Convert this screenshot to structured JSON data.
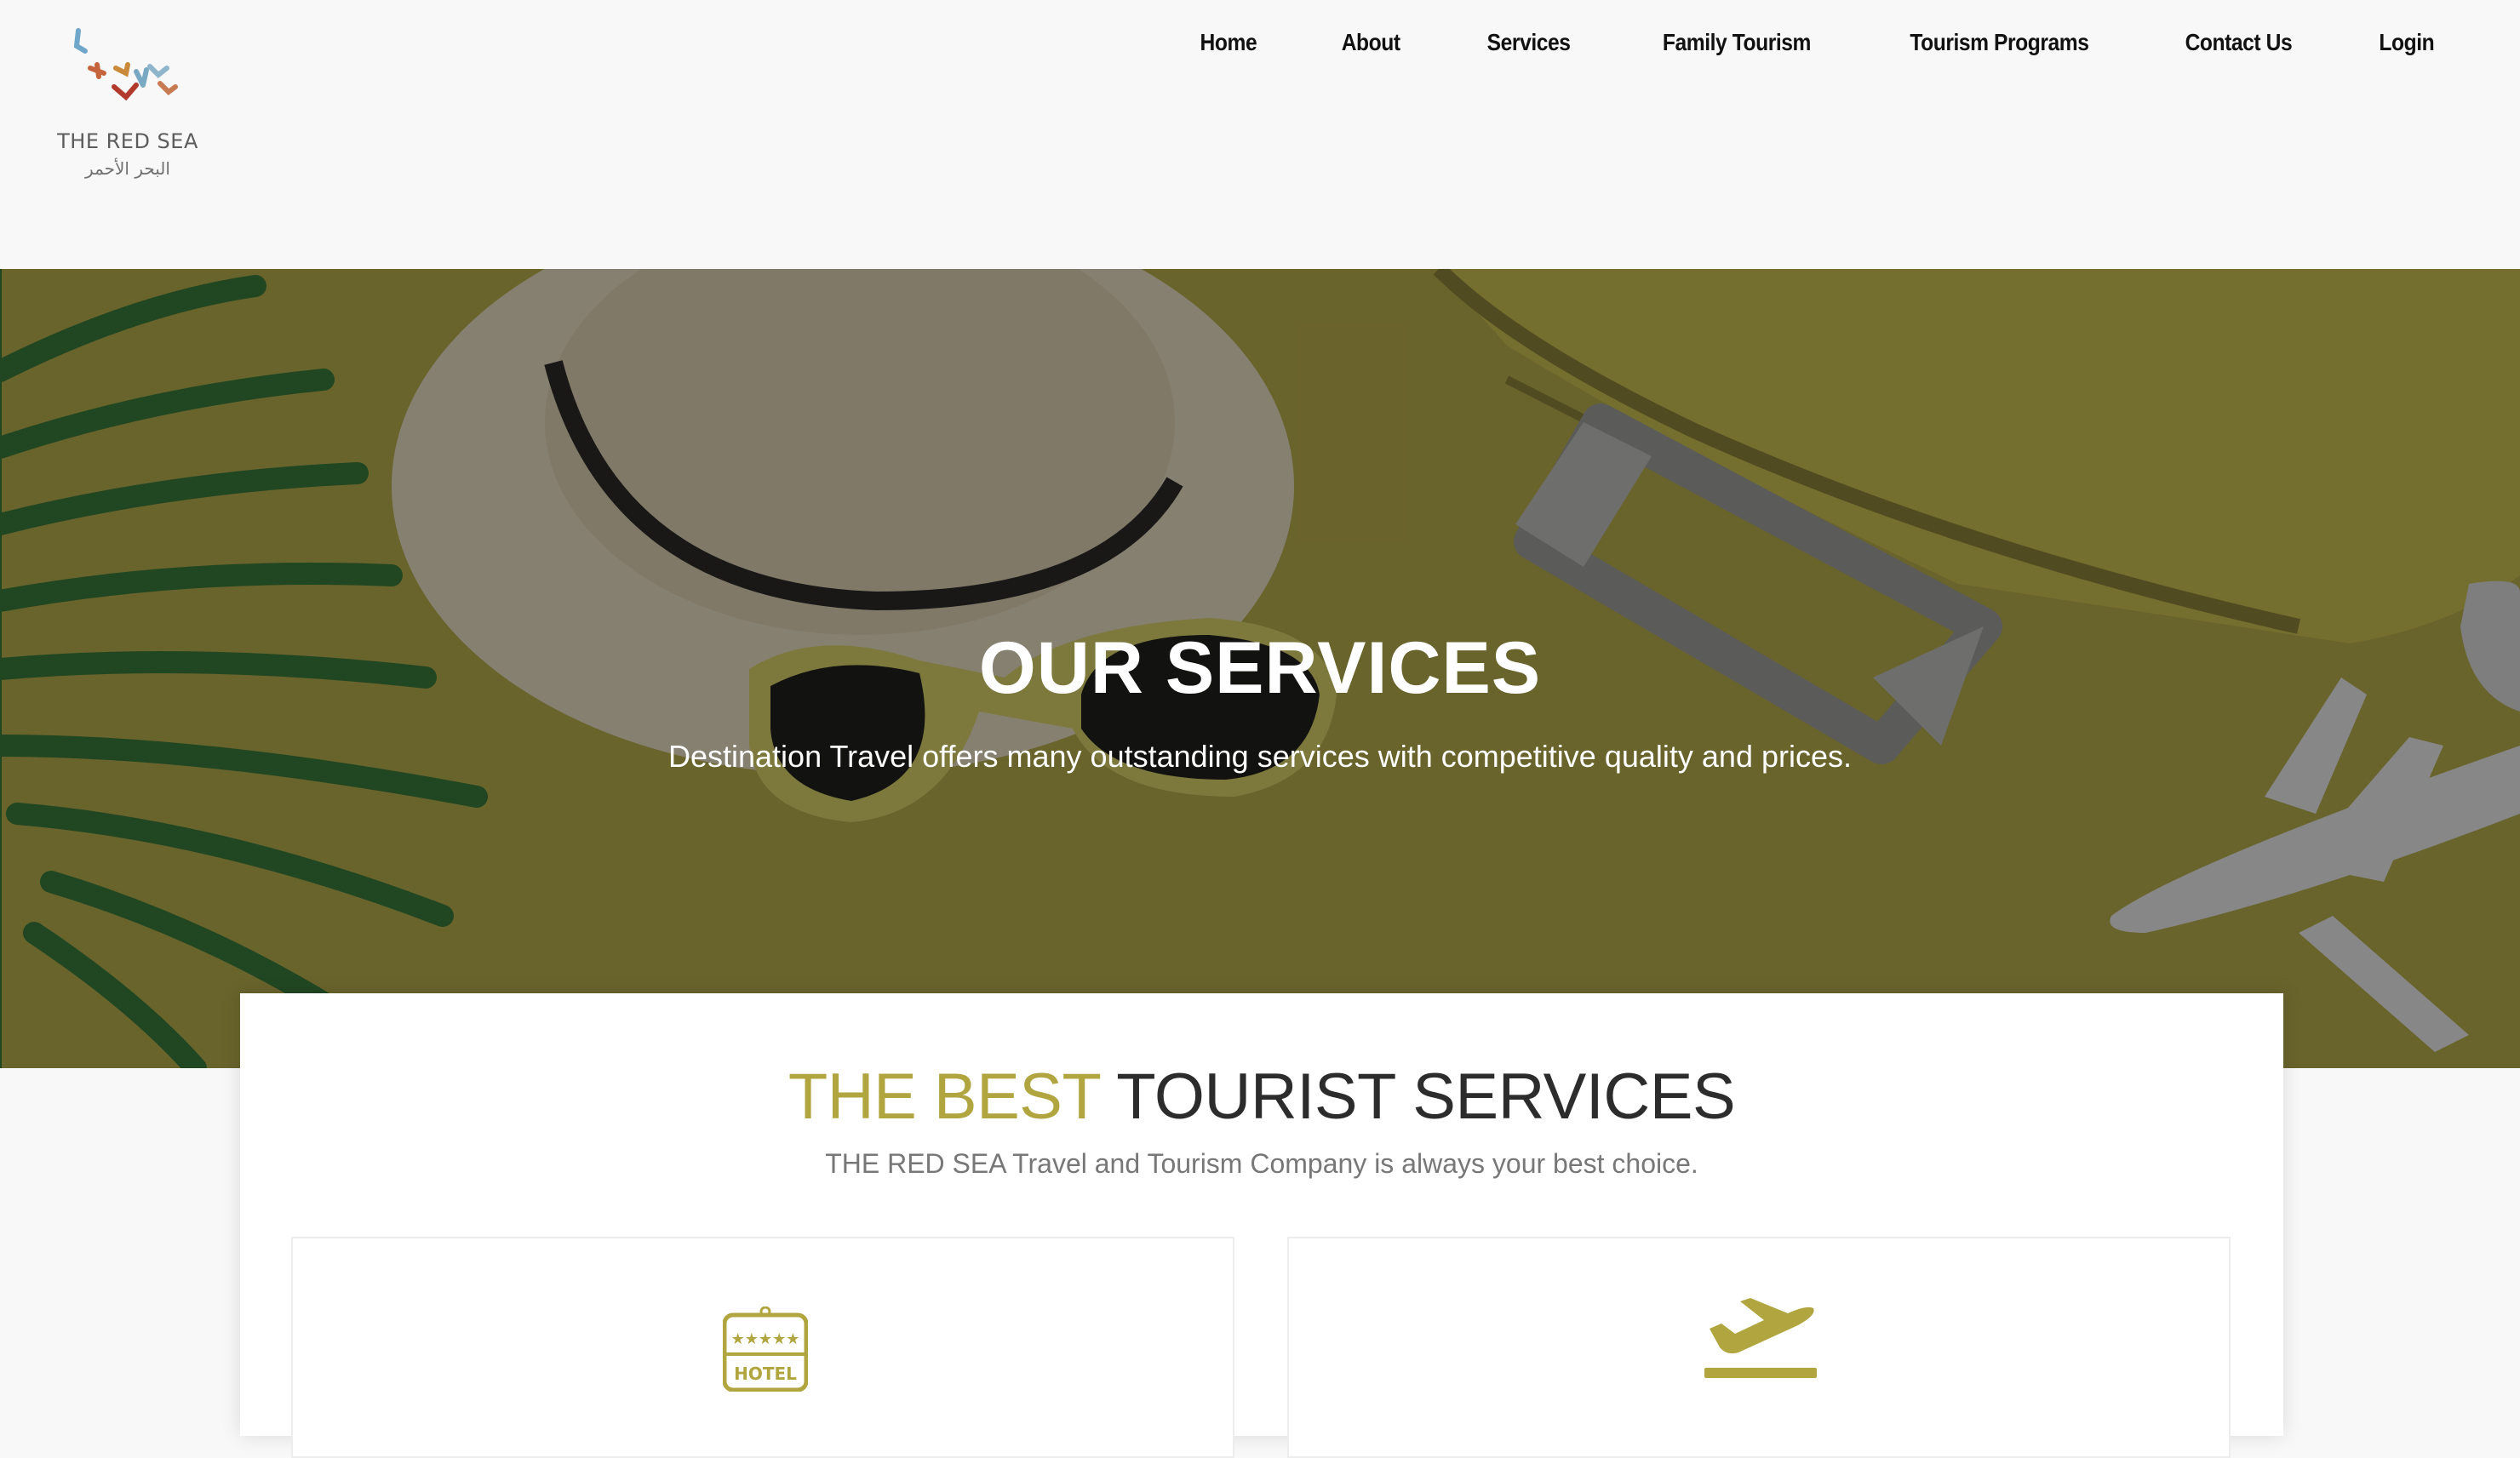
{
  "header": {
    "logo_text_en": "THE RED SEA",
    "logo_text_ar": "البحر الأحمر",
    "nav": [
      {
        "label": "Home"
      },
      {
        "label": "About"
      },
      {
        "label": "Services"
      },
      {
        "label": "Family Tourism"
      },
      {
        "label": "Tourism Programs"
      },
      {
        "label": "Contact Us"
      },
      {
        "label": "Login"
      }
    ]
  },
  "hero": {
    "title": "OUR SERVICES",
    "subtitle": "Destination Travel offers many outstanding services with competitive quality and prices."
  },
  "section": {
    "title_accent": "THE BEST",
    "title_rest": " TOURIST SERVICES",
    "subtitle": "THE RED SEA Travel and Tourism Company is always your best choice.",
    "services": [
      {
        "icon": "hotel-icon",
        "icon_text": "HOTEL",
        "icon_stars": "★★★★★"
      },
      {
        "icon": "airplane-takeoff-icon"
      }
    ]
  },
  "colors": {
    "accent": "#b1a53f",
    "hero_background": "#b3a94b",
    "header_background": "#f8f8f8"
  }
}
